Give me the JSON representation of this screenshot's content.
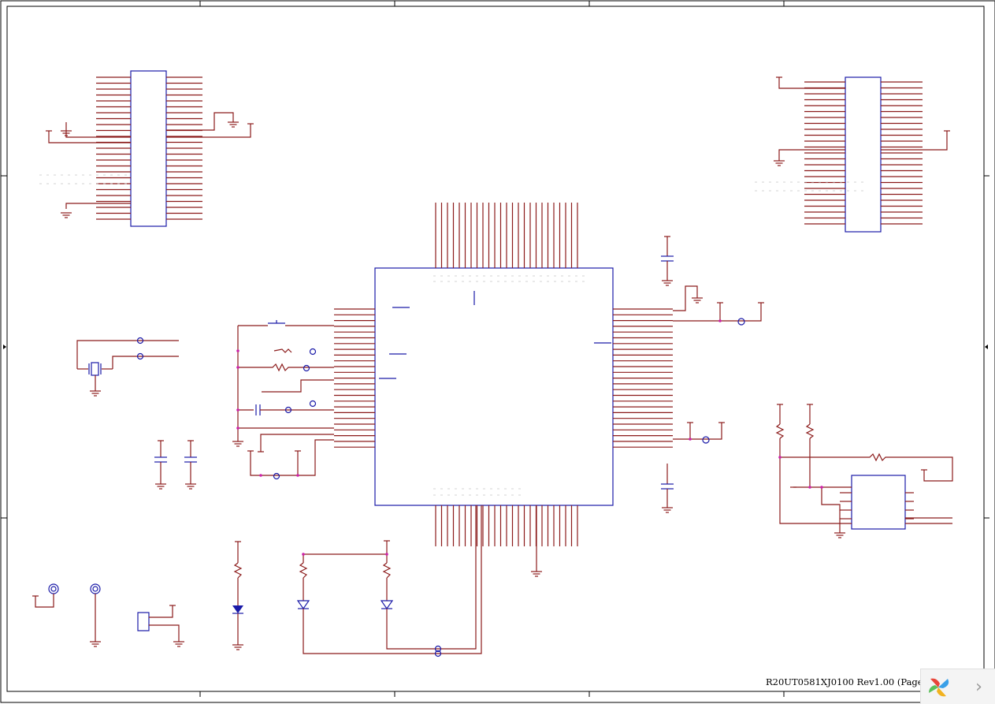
{
  "document": {
    "title_block": "R20UT0581XJ0100 Rev1.00 (Page 2 of 2)"
  },
  "viewer": {
    "next_icon": "chevron-right-icon",
    "next_glyph": "›",
    "logo_icon": "pinwheel-logo-icon"
  },
  "colors": {
    "wire": "#8b1a1a",
    "component": "#1a1aa8",
    "junction": "#cc22aa",
    "frame": "#000000"
  }
}
